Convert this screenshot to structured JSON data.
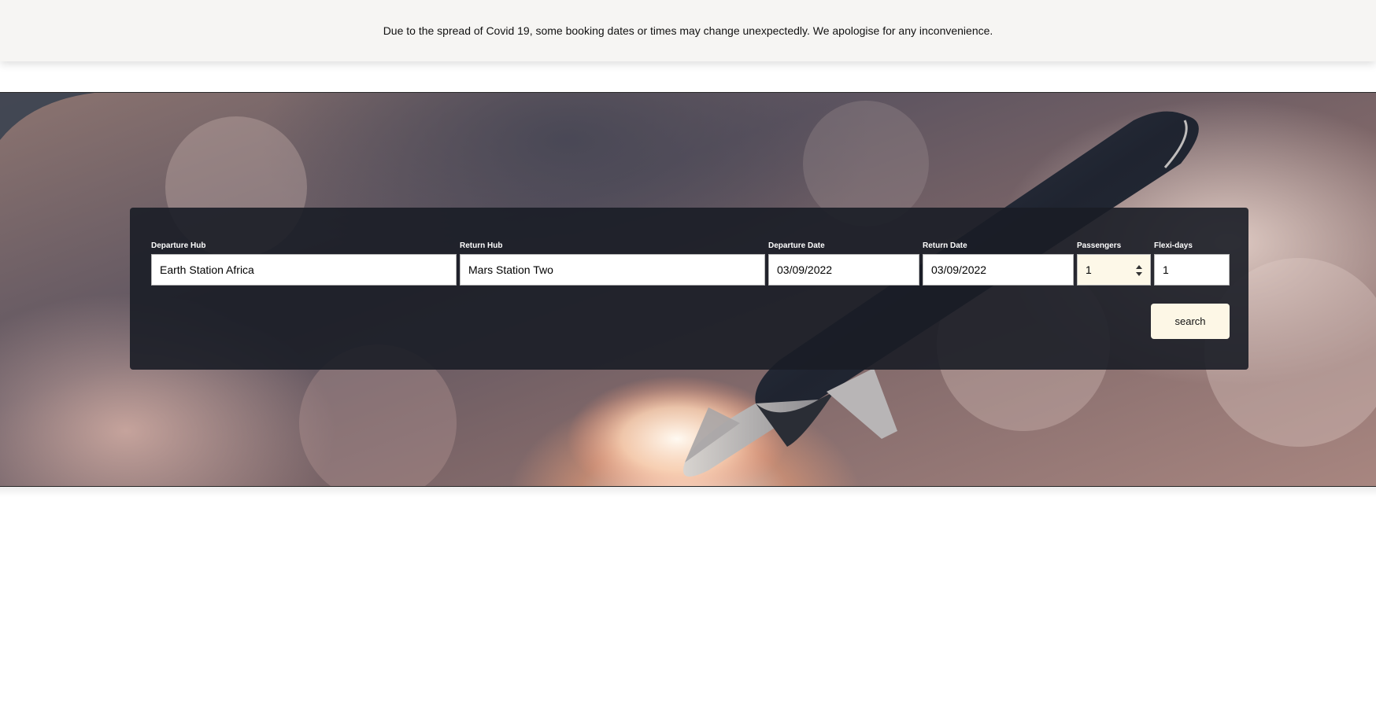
{
  "notice": {
    "text": "Due to the spread of Covid 19, some booking dates or times may change unexpectedly. We apologise for any inconvenience."
  },
  "booking": {
    "departure_hub": {
      "label": "Departure Hub",
      "value": "Earth Station Africa"
    },
    "return_hub": {
      "label": "Return Hub",
      "value": "Mars Station Two"
    },
    "departure_date": {
      "label": "Departure Date",
      "value": "03/09/2022"
    },
    "return_date": {
      "label": "Return Date",
      "value": "03/09/2022"
    },
    "passengers": {
      "label": "Passengers",
      "value": "1"
    },
    "flexi_days": {
      "label": "Flexi-days",
      "value": "1"
    },
    "search_label": "search"
  },
  "hero": {
    "image": "rocket-launch-through-clouds"
  },
  "colors": {
    "notice_bg": "#f6f5f3",
    "panel_bg": "#1a1d26",
    "button_bg": "#fdf7e6",
    "passengers_bg": "#fdf8e8"
  }
}
